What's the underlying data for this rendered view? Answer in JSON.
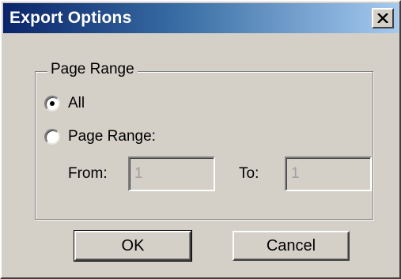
{
  "window": {
    "title": "Export Options",
    "close_icon": "close-icon"
  },
  "group": {
    "label": "Page Range"
  },
  "options": [
    {
      "label": "All",
      "selected": true
    },
    {
      "label": "Page Range:",
      "selected": false
    }
  ],
  "range": {
    "from_label": "From:",
    "from_value": "1",
    "to_label": "To:",
    "to_value": "1"
  },
  "buttons": {
    "ok_label": "OK",
    "cancel_label": "Cancel"
  },
  "colors": {
    "dialog_face": "#d4d0c8",
    "titlebar_start": "#0a246a",
    "titlebar_end": "#a6caf0",
    "disabled_text": "#a0a0a0"
  }
}
